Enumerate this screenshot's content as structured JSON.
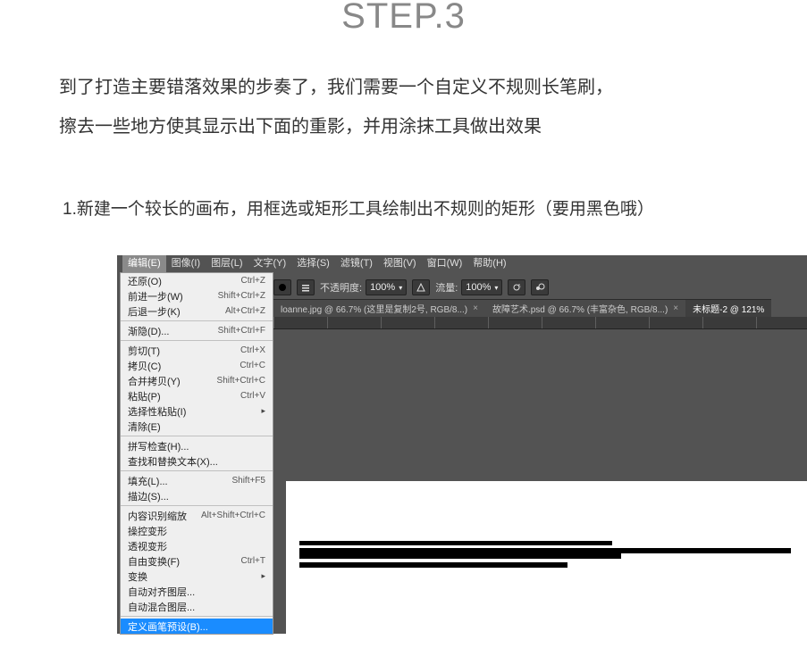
{
  "title": "STEP.3",
  "intro_line1": "到了打造主要错落效果的步奏了，我们需要一个自定义不规则长笔刷，",
  "intro_line2": "擦去一些地方使其显示出下面的重影，并用涂抹工具做出效果",
  "instruction": "1.新建一个较长的画布，用框选或矩形工具绘制出不规则的矩形（要用黑色哦）",
  "menubar": {
    "items": [
      "编辑(E)",
      "图像(I)",
      "图层(L)",
      "文字(Y)",
      "选择(S)",
      "滤镜(T)",
      "视图(V)",
      "窗口(W)",
      "帮助(H)"
    ],
    "active_index": 0
  },
  "optbar": {
    "opacity_label": "不透明度:",
    "opacity_value": "100%",
    "flow_label": "流量:",
    "flow_value": "100%"
  },
  "tabs": {
    "items": [
      {
        "label": "loanne.jpg @ 66.7% (这里是复制2号, RGB/8...)"
      },
      {
        "label": "故障艺术.psd @ 66.7% (丰富杂色, RGB/8...)"
      },
      {
        "label": "未标题-2 @ 121%"
      }
    ],
    "active_index": 2
  },
  "edit_menu": {
    "groups": [
      [
        {
          "label": "还原(O)",
          "shortcut": "Ctrl+Z"
        },
        {
          "label": "前进一步(W)",
          "shortcut": "Shift+Ctrl+Z"
        },
        {
          "label": "后退一步(K)",
          "shortcut": "Alt+Ctrl+Z"
        }
      ],
      [
        {
          "label": "渐隐(D)...",
          "shortcut": "Shift+Ctrl+F"
        }
      ],
      [
        {
          "label": "剪切(T)",
          "shortcut": "Ctrl+X"
        },
        {
          "label": "拷贝(C)",
          "shortcut": "Ctrl+C"
        },
        {
          "label": "合并拷贝(Y)",
          "shortcut": "Shift+Ctrl+C"
        },
        {
          "label": "粘贴(P)",
          "shortcut": "Ctrl+V"
        },
        {
          "label": "选择性粘贴(I)",
          "shortcut": "",
          "submenu": true
        },
        {
          "label": "清除(E)",
          "shortcut": ""
        }
      ],
      [
        {
          "label": "拼写检查(H)...",
          "shortcut": ""
        },
        {
          "label": "查找和替换文本(X)...",
          "shortcut": ""
        }
      ],
      [
        {
          "label": "填充(L)...",
          "shortcut": "Shift+F5"
        },
        {
          "label": "描边(S)...",
          "shortcut": ""
        }
      ],
      [
        {
          "label": "内容识别缩放",
          "shortcut": "Alt+Shift+Ctrl+C"
        },
        {
          "label": "操控变形",
          "shortcut": ""
        },
        {
          "label": "透视变形",
          "shortcut": ""
        },
        {
          "label": "自由变换(F)",
          "shortcut": "Ctrl+T"
        },
        {
          "label": "变换",
          "shortcut": "",
          "submenu": true
        },
        {
          "label": "自动对齐图层...",
          "shortcut": ""
        },
        {
          "label": "自动混合图层...",
          "shortcut": ""
        }
      ],
      [
        {
          "label": "定义画笔预设(B)...",
          "shortcut": "",
          "selected": true
        }
      ]
    ]
  }
}
